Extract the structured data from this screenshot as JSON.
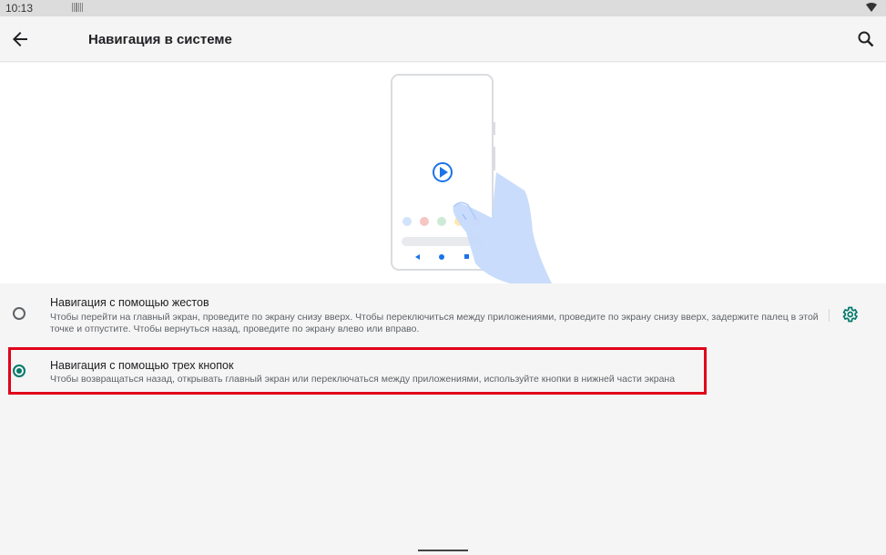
{
  "status_bar": {
    "time": "10:13",
    "notification_icon": "barcode-icon",
    "wifi_icon": "wifi-icon"
  },
  "app_bar": {
    "title": "Навигация в системе",
    "back_icon": "arrow-back-icon",
    "search_icon": "search-icon"
  },
  "illustration": {
    "description_icon": "phone-hand-illustration",
    "accent": "#1a73e8",
    "hand_color": "#c6dafc"
  },
  "options": [
    {
      "title": "Навигация с помощью жестов",
      "description": "Чтобы перейти на главный экран, проведите по экрану снизу вверх. Чтобы переключиться между приложениями, проведите по экрану снизу вверх, задержите палец в этой точке и отпустите. Чтобы вернуться назад, проведите по экрану влево или вправо.",
      "selected": false,
      "settings_icon": "gear-icon"
    },
    {
      "title": "Навигация с помощью трех кнопок",
      "description": "Чтобы возвращаться назад, открывать главный экран или переключаться между приложениями, используйте кнопки в нижней части экрана",
      "selected": true
    }
  ],
  "colors": {
    "accent": "#00796b",
    "highlight": "#e0001b",
    "background": "#f5f5f5"
  }
}
